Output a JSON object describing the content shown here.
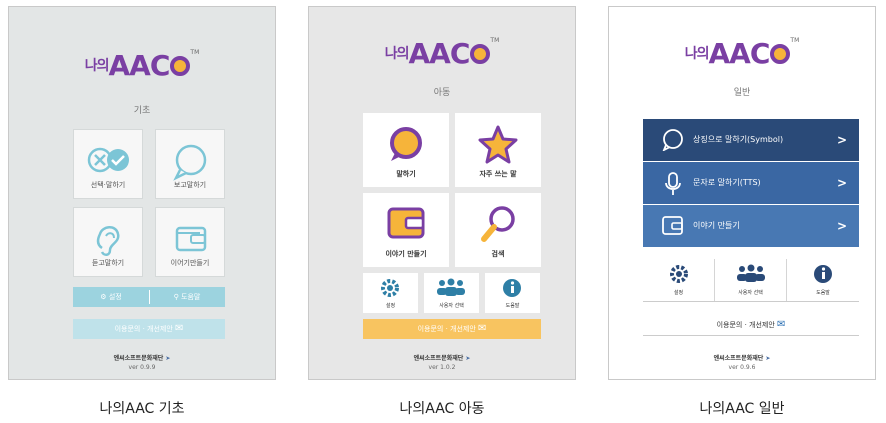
{
  "logo": {
    "korean": "나의",
    "latin": "AAC",
    "tm": "TM"
  },
  "panels": [
    {
      "subtitle": "기초",
      "tiles": [
        "선택·말하기",
        "보고말하기",
        "듣고말하기",
        "이어기만들기"
      ],
      "settings_label": "설정",
      "help_label": "도움말",
      "inquiry_label": "이용문의 · 개선제안",
      "org": "엔씨소프트문화재단",
      "version": "ver 0.9.9",
      "caption": "나의AAC 기초"
    },
    {
      "subtitle": "아동",
      "tiles": [
        "말하기",
        "자주 쓰는 말",
        "이야기 만들기",
        "검색"
      ],
      "mini": [
        "설정",
        "사용자 선택",
        "도움말"
      ],
      "inquiry_label": "이용문의 · 개선제안",
      "org": "엔씨소프트문화재단",
      "version": "ver 1.0.2",
      "caption": "나의AAC 아동"
    },
    {
      "subtitle": "일반",
      "rows": [
        "상징으로 말하기(Symbol)",
        "문자로 말하기(TTS)",
        "이야기 만들기"
      ],
      "chevron": ">",
      "mini": [
        "설정",
        "사용자 선택",
        "도움말"
      ],
      "inquiry_label": "이용문의 · 개선제안",
      "org": "엔씨소프트문화재단",
      "version": "ver 0.9.6",
      "caption": "나의AAC 일반"
    }
  ],
  "colors": {
    "purple": "#7a3fa3",
    "orange": "#f6b43a",
    "teal": "#9cd3df",
    "navy1": "#2a4a78",
    "navy2": "#3a67a3",
    "navy3": "#4878b3"
  }
}
